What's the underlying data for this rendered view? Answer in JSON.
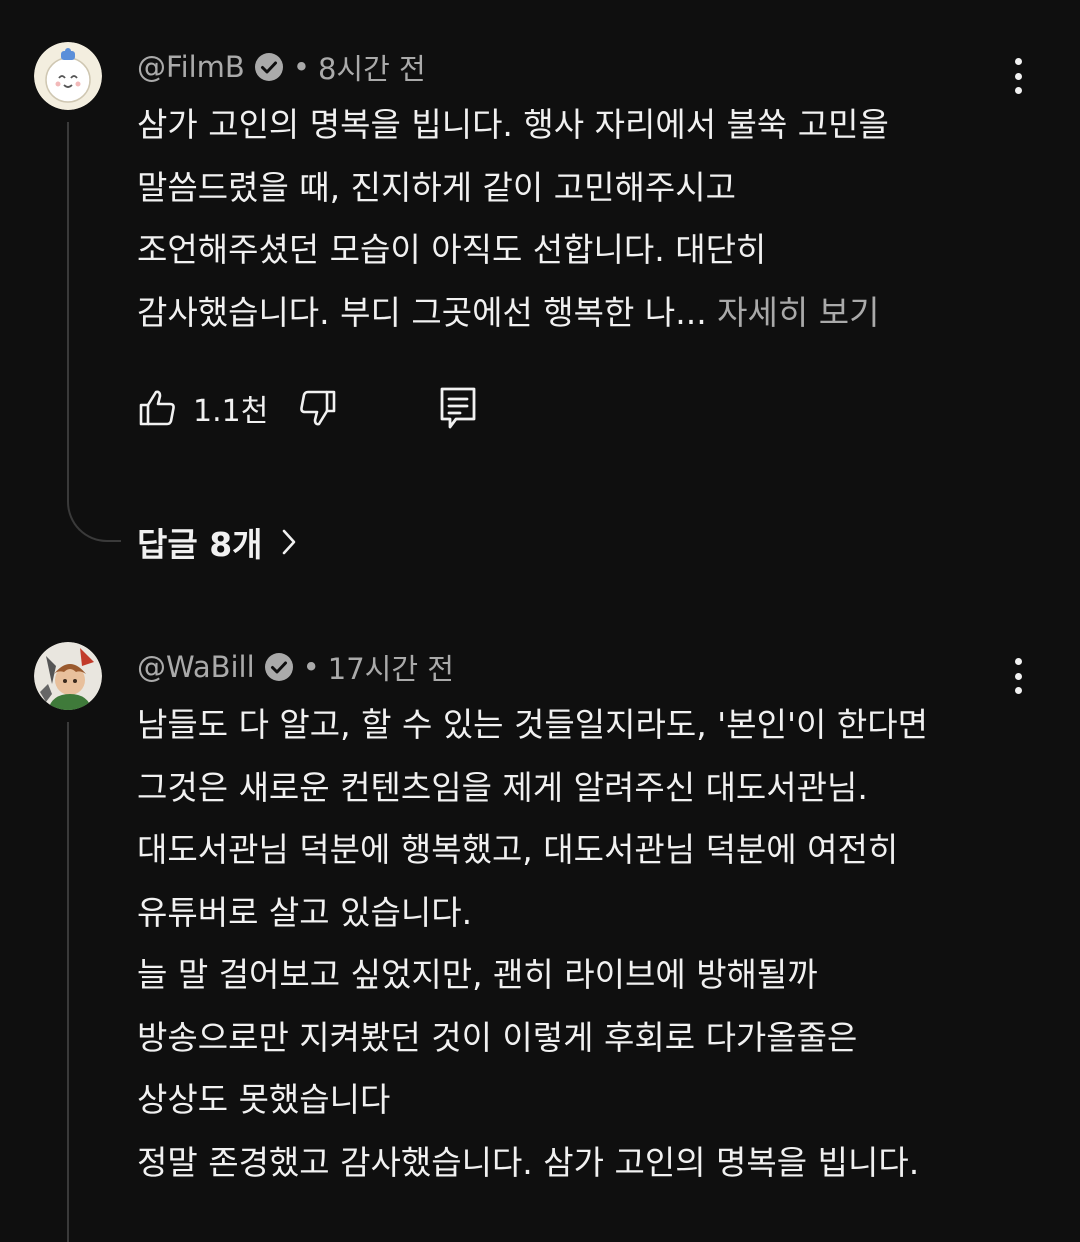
{
  "comments": [
    {
      "author": "@FilmB",
      "separator": "•",
      "time": "8시간 전",
      "lines": [
        "삼가 고인의 명복을 빕니다. 행사 자리에서 불쑥 고민을",
        "말씀드렸을 때, 진지하게 같이 고민해주시고",
        "조언해주셨던 모습이 아직도 선합니다. 대단히",
        "감사했습니다. 부디 그곳에선 행복한 나..."
      ],
      "more_label": " 자세히 보기",
      "like_count": "1.1천",
      "replies_label": "답글 8개"
    },
    {
      "author": "@WaBill",
      "separator": "•",
      "time": "17시간 전",
      "lines": [
        "남들도 다 알고, 할 수 있는 것들일지라도, '본인'이 한다면",
        "그것은 새로운 컨텐츠임을 제게 알려주신 대도서관님.",
        "대도서관님 덕분에 행복했고, 대도서관님 덕분에 여전히",
        "유튜버로 살고 있습니다.",
        "늘 말 걸어보고 싶었지만, 괜히 라이브에 방해될까",
        "방송으로만 지켜봤던 것이 이렇게 후회로 다가올줄은",
        "상상도 못했습니다",
        "정말 존경했고 감사했습니다. 삼가 고인의 명복을 빕니다."
      ]
    }
  ],
  "icons": {
    "verified": "verified-check-icon",
    "menu": "more-vert-icon",
    "like": "thumb-up-icon",
    "dislike": "thumb-down-icon",
    "reply": "comment-reply-icon",
    "chevron": "chevron-right-icon"
  },
  "colors": {
    "background": "#0f0f0f",
    "text": "#f1f1f1",
    "secondary": "#aaaaaa"
  }
}
